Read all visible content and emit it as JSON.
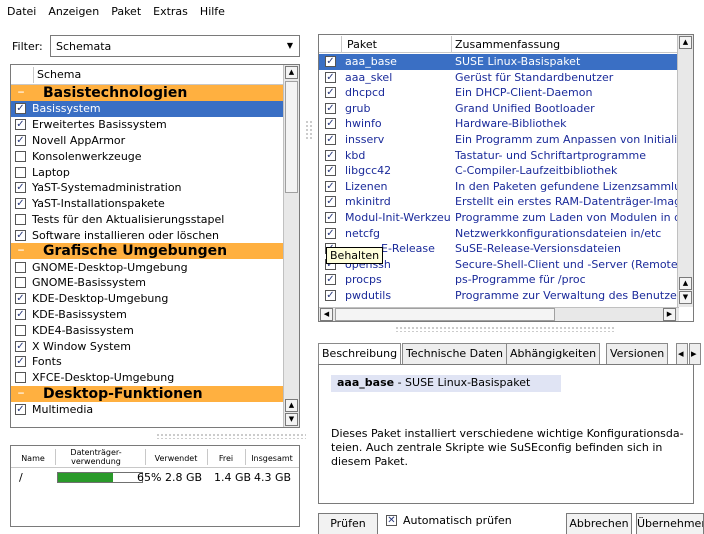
{
  "menu": [
    "Datei",
    "Anzeigen",
    "Paket",
    "Extras",
    "Hilfe"
  ],
  "filter": {
    "label": "Filter:",
    "value": "Schemata"
  },
  "patterns": {
    "header": "Schema",
    "rows": [
      {
        "type": "category",
        "label": "Basistechnologien"
      },
      {
        "type": "item",
        "label": "Basissystem",
        "checked": true,
        "selected": true
      },
      {
        "type": "item",
        "label": "Erweitertes Basissystem",
        "checked": true
      },
      {
        "type": "item",
        "label": "Novell AppArmor",
        "checked": true
      },
      {
        "type": "item",
        "label": "Konsolenwerkzeuge",
        "checked": false
      },
      {
        "type": "item",
        "label": "Laptop",
        "checked": false
      },
      {
        "type": "item",
        "label": "YaST-Systemadministration",
        "checked": true
      },
      {
        "type": "item",
        "label": "YaST-Installationspakete",
        "checked": true
      },
      {
        "type": "item",
        "label": "Tests für den Aktualisierungsstapel",
        "checked": false
      },
      {
        "type": "item",
        "label": "Software installieren oder löschen",
        "checked": true
      },
      {
        "type": "category",
        "label": "Grafische Umgebungen"
      },
      {
        "type": "item",
        "label": "GNOME-Desktop-Umgebung",
        "checked": false
      },
      {
        "type": "item",
        "label": "GNOME-Basissystem",
        "checked": false
      },
      {
        "type": "item",
        "label": "KDE-Desktop-Umgebung",
        "checked": true
      },
      {
        "type": "item",
        "label": "KDE-Basissystem",
        "checked": true
      },
      {
        "type": "item",
        "label": "KDE4-Basissystem",
        "checked": false
      },
      {
        "type": "item",
        "label": "X Window System",
        "checked": true
      },
      {
        "type": "item",
        "label": "Fonts",
        "checked": true
      },
      {
        "type": "item",
        "label": "XFCE-Desktop-Umgebung",
        "checked": false
      },
      {
        "type": "category",
        "label": "Desktop-Funktionen"
      },
      {
        "type": "item",
        "label": "Multimedia",
        "checked": true
      }
    ]
  },
  "disk": {
    "headers": {
      "name": "Name",
      "usage": "Datenträger-verwendung",
      "used": "Verwendet",
      "free": "Frei",
      "total": "Insgesamt"
    },
    "row": {
      "name": "/",
      "percent_label": "65%",
      "fraction": 0.65,
      "used": "2.8 GB",
      "free": "1.4 GB",
      "total": "4.3 GB"
    }
  },
  "packages": {
    "headers": {
      "name": "Paket",
      "summary": "Zusammenfassung"
    },
    "rows": [
      {
        "name": "aaa_base",
        "summary": "SUSE Linux-Basispaket",
        "selected": true
      },
      {
        "name": "aaa_skel",
        "summary": "Gerüst für Standardbenutzer"
      },
      {
        "name": "dhcpcd",
        "summary": "Ein DHCP-Client-Daemon"
      },
      {
        "name": "grub",
        "summary": "Grand Unified Bootloader"
      },
      {
        "name": "hwinfo",
        "summary": "Hardware-Bibliothek"
      },
      {
        "name": "insserv",
        "summary": "Ein Programm zum Anpassen von Initialisie"
      },
      {
        "name": "kbd",
        "summary": "Tastatur- und Schriftartprogramme"
      },
      {
        "name": "libgcc42",
        "summary": "C-Compiler-Laufzeitbibliothek"
      },
      {
        "name": "Lizenen",
        "summary": "In den Paketen gefundene Lizenzsammlun"
      },
      {
        "name": "mkinitrd",
        "summary": "Erstellt ein erstes RAM-Datenträger-Image"
      },
      {
        "name": "Modul-Init-Werkzeu",
        "summary": "Programme zum Laden von Modulen in den"
      },
      {
        "name": "netcfg",
        "summary": "Netzwerkkonfigurationsdateien in/etc"
      },
      {
        "name": "E-Release",
        "summary": "SuSE-Release-Versionsdateien"
      },
      {
        "name": "openssh",
        "summary": "Secure-Shell-Client und -Server (Remote L"
      },
      {
        "name": "procps",
        "summary": "ps-Programme für /proc"
      },
      {
        "name": "pwdutils",
        "summary": "Programme zur Verwaltung des Benutzer- u"
      }
    ],
    "tooltip": "Behalten"
  },
  "tabs": [
    "Beschreibung",
    "Technische Daten",
    "Abhängigkeiten",
    "Versionen"
  ],
  "description": {
    "pkg_name": "aaa_base",
    "pkg_summary": " - SUSE Linux-Basispaket",
    "text": "Dieses Paket installiert verschiedene wichtige Konfigurationsda-teien. Auch zentrale Skripte wie SuSEconfig befinden sich in diesem Paket."
  },
  "buttons": {
    "check": "Prüfen",
    "auto_check": "Automatisch prüfen",
    "cancel": "Abbrechen",
    "accept": "Übernehmen"
  },
  "colors": {
    "category_bg": "#ffb040",
    "selection": "#3a6fc4",
    "link_text": "#1a2a9a",
    "disk_fill": "#2a9a2a"
  }
}
